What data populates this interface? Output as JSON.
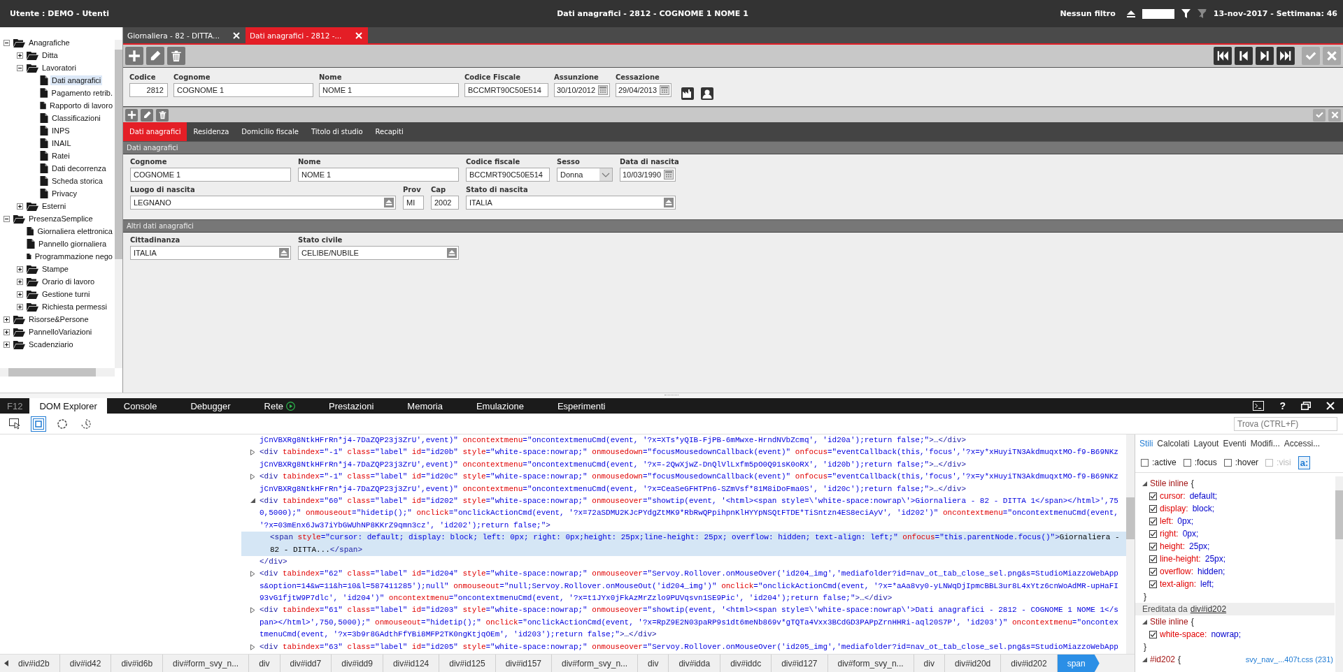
{
  "header": {
    "user": "Utente : DEMO - Utenti",
    "title": "Dati anagrafici - 2812 - COGNOME 1 NOME 1",
    "filter_label": "Nessun filtro",
    "date": "13-nov-2017 - Settimana: 46"
  },
  "tree": [
    {
      "label": "Anagrafiche",
      "kind": "folder",
      "expanded": true,
      "selected": false,
      "children": [
        {
          "label": "Ditta",
          "kind": "folder",
          "expanded": false,
          "selected": false
        },
        {
          "label": "Lavoratori",
          "kind": "folder",
          "expanded": true,
          "selected": false,
          "children": [
            {
              "label": "Dati anagrafici",
              "kind": "document",
              "selected": true
            },
            {
              "label": "Pagamento retrib.",
              "kind": "document",
              "selected": false
            },
            {
              "label": "Rapporto di lavoro",
              "kind": "document",
              "selected": false
            },
            {
              "label": "Classificazioni",
              "kind": "document",
              "selected": false
            },
            {
              "label": "INPS",
              "kind": "document",
              "selected": false
            },
            {
              "label": "INAIL",
              "kind": "document",
              "selected": false
            },
            {
              "label": "Ratei",
              "kind": "document",
              "selected": false
            },
            {
              "label": "Dati decorrenza",
              "kind": "document",
              "selected": false
            },
            {
              "label": "Scheda storica",
              "kind": "document",
              "selected": false
            },
            {
              "label": "Privacy",
              "kind": "document",
              "selected": false
            }
          ]
        },
        {
          "label": "Esterni",
          "kind": "folder",
          "expanded": false,
          "selected": false
        }
      ]
    },
    {
      "label": "PresenzaSemplice",
      "kind": "folder",
      "expanded": true,
      "selected": false,
      "children": [
        {
          "label": "Giornaliera elettronica",
          "kind": "document",
          "selected": false
        },
        {
          "label": "Pannello giornaliera",
          "kind": "document",
          "selected": false
        },
        {
          "label": "Programmazione nego",
          "kind": "document",
          "selected": false
        },
        {
          "label": "Stampe",
          "kind": "folder",
          "expanded": false,
          "selected": false
        },
        {
          "label": "Orario di lavoro",
          "kind": "folder",
          "expanded": false,
          "selected": false
        },
        {
          "label": "Gestione turni",
          "kind": "folder",
          "expanded": false,
          "selected": false
        },
        {
          "label": "Richiesta permessi",
          "kind": "folder",
          "expanded": false,
          "selected": false
        }
      ]
    },
    {
      "label": "Risorse&Persone",
      "kind": "folder",
      "expanded": false,
      "selected": false
    },
    {
      "label": "PannelloVariazioni",
      "kind": "folder",
      "expanded": false,
      "selected": false
    },
    {
      "label": "Scadenziario",
      "kind": "folder",
      "expanded": false,
      "selected": false
    }
  ],
  "doc_tabs": [
    {
      "label": "Giornaliera - 82 - DITTA...",
      "selected": false
    },
    {
      "label": "Dati anagrafici - 2812 -...",
      "selected": true
    }
  ],
  "toolbar": [
    {
      "kind": "add",
      "disabled": false
    },
    {
      "kind": "edit",
      "disabled": false
    },
    {
      "kind": "delete",
      "disabled": false
    },
    {
      "kind": "first",
      "disabled": false
    },
    {
      "kind": "previous",
      "disabled": false
    },
    {
      "kind": "next",
      "disabled": false
    },
    {
      "kind": "last",
      "disabled": false
    },
    {
      "kind": "confirm",
      "disabled": true
    },
    {
      "kind": "cancel",
      "disabled": true
    }
  ],
  "record": [
    {
      "label": "Codice",
      "value": "2812",
      "kind": "number"
    },
    {
      "label": "Cognome",
      "value": "COGNOME 1",
      "kind": "text"
    },
    {
      "label": "Nome",
      "value": "NOME 1",
      "kind": "text"
    },
    {
      "label": "Codice Fiscale",
      "value": "BCCMRT90C50E514",
      "kind": "text"
    },
    {
      "label": "Assunzione",
      "value": "30/10/2012",
      "kind": "date"
    },
    {
      "label": "Cessazione",
      "value": "29/04/2013",
      "kind": "date"
    }
  ],
  "sub_toolbar": [
    {
      "kind": "add",
      "disabled": false
    },
    {
      "kind": "edit",
      "disabled": false
    },
    {
      "kind": "delete",
      "disabled": false
    },
    {
      "kind": "confirm",
      "disabled": true
    },
    {
      "kind": "cancel",
      "disabled": true
    }
  ],
  "sub_tabs": [
    {
      "label": "Dati anagrafici",
      "selected": true
    },
    {
      "label": "Residenza",
      "selected": false
    },
    {
      "label": "Domicilio fiscale",
      "selected": false
    },
    {
      "label": "Titolo di studio",
      "selected": false
    },
    {
      "label": "Recapiti",
      "selected": false
    }
  ],
  "sections": [
    {
      "title": "Dati anagrafici",
      "fields": [
        {
          "label": "Cognome",
          "value": "COGNOME 1",
          "kind": "text"
        },
        {
          "label": "Nome",
          "value": "NOME 1",
          "kind": "text"
        },
        {
          "label": "Codice fiscale",
          "value": "BCCMRT90C50E514",
          "kind": "text"
        },
        {
          "label": "Sesso",
          "value": "Donna",
          "kind": "select"
        },
        {
          "label": "Data di nascita",
          "value": "10/03/1990",
          "kind": "date"
        },
        {
          "label": "Luogo di nascita",
          "value": "LEGNANO",
          "kind": "lookup"
        },
        {
          "label": "Prov",
          "value": "MI",
          "kind": "text"
        },
        {
          "label": "Cap",
          "value": "2002",
          "kind": "text"
        },
        {
          "label": "Stato di nascita",
          "value": "ITALIA",
          "kind": "lookup"
        }
      ]
    },
    {
      "title": "Altri dati anagrafici",
      "fields": [
        {
          "label": "Cittadinanza",
          "value": "ITALIA",
          "kind": "lookup"
        },
        {
          "label": "Stato civile",
          "value": "CELIBE/NUBILE",
          "kind": "lookup"
        }
      ]
    }
  ],
  "devtools": {
    "f12": "F12",
    "tabs": [
      {
        "label": "DOM Explorer",
        "selected": true,
        "kind": "plain"
      },
      {
        "label": "Console",
        "selected": false,
        "kind": "plain"
      },
      {
        "label": "Debugger",
        "selected": false,
        "kind": "plain"
      },
      {
        "label": "Rete",
        "selected": false,
        "kind": "play"
      },
      {
        "label": "Prestazioni",
        "selected": false,
        "kind": "plain"
      },
      {
        "label": "Memoria",
        "selected": false,
        "kind": "plain"
      },
      {
        "label": "Emulazione",
        "selected": false,
        "kind": "plain"
      },
      {
        "label": "Esperimenti",
        "selected": false,
        "kind": "plain"
      }
    ],
    "help": "?",
    "tools": [
      {
        "kind": "select",
        "selected": false
      },
      {
        "kind": "box",
        "selected": true
      },
      {
        "kind": "circle",
        "selected": false
      },
      {
        "kind": "clock",
        "selected": false
      }
    ],
    "find": {
      "placeholder": "Trova (CTRL+F)"
    },
    "dom": [
      {
        "kind": "tail",
        "selected": false,
        "lines": [
          [
            {
              "kind": "val",
              "text": "jCnVBXRg8NtkHFrRn*j4-7DaZQP23j3ZrU',event)\""
            },
            {
              "kind": "attr",
              "text": " oncontextmenu"
            },
            {
              "kind": "val",
              "text": "=\"oncontextmenuCmd(event, '?x=XTs*yQIB-FjPB-6mMwxe-HrndNVbZcmq', 'id20a');return false;\""
            },
            {
              "kind": "tag",
              "text": ">…</div>"
            }
          ]
        ]
      },
      {
        "kind": "collapsed",
        "selected": false,
        "lines": [
          [
            {
              "kind": "tag",
              "text": "<div"
            },
            {
              "kind": "attr",
              "text": " tabindex"
            },
            {
              "kind": "val",
              "text": "=\"-1\""
            },
            {
              "kind": "attr",
              "text": " class"
            },
            {
              "kind": "val",
              "text": "=\"label\""
            },
            {
              "kind": "attr",
              "text": " id"
            },
            {
              "kind": "val",
              "text": "=\"id20b\""
            },
            {
              "kind": "attr",
              "text": " style"
            },
            {
              "kind": "val",
              "text": "=\"white-space:nowrap;\""
            },
            {
              "kind": "attr",
              "text": " onmousedown"
            },
            {
              "kind": "val",
              "text": "=\"focusMousedownCallback(event)\""
            },
            {
              "kind": "attr",
              "text": " onfocus"
            },
            {
              "kind": "val",
              "text": "=\"eventCallback(this,'focus','?x=y*xHuyiTN3AkdmuqxtMO-f9-B69NKz"
            }
          ],
          [
            {
              "kind": "val",
              "text": "jCnVBXRg8NtkHFrRn*j4-7DaZQP23j3ZrU',event)\""
            },
            {
              "kind": "attr",
              "text": " oncontextmenu"
            },
            {
              "kind": "val",
              "text": "=\"oncontextmenuCmd(event, '?x=-2QwXjwZ-DnQlVlLxfm5pO0Q91sK0oRX', 'id20b');return false;\""
            },
            {
              "kind": "tag",
              "text": ">…</div>"
            }
          ]
        ]
      },
      {
        "kind": "collapsed",
        "selected": false,
        "lines": [
          [
            {
              "kind": "tag",
              "text": "<div"
            },
            {
              "kind": "attr",
              "text": " tabindex"
            },
            {
              "kind": "val",
              "text": "=\"-1\""
            },
            {
              "kind": "attr",
              "text": " class"
            },
            {
              "kind": "val",
              "text": "=\"label\""
            },
            {
              "kind": "attr",
              "text": " id"
            },
            {
              "kind": "val",
              "text": "=\"id20c\""
            },
            {
              "kind": "attr",
              "text": " style"
            },
            {
              "kind": "val",
              "text": "=\"white-space:nowrap;\""
            },
            {
              "kind": "attr",
              "text": " onmousedown"
            },
            {
              "kind": "val",
              "text": "=\"focusMousedownCallback(event)\""
            },
            {
              "kind": "attr",
              "text": " onfocus"
            },
            {
              "kind": "val",
              "text": "=\"eventCallback(this,'focus','?x=y*xHuyiTN3AkdmuqxtMO-f9-B69NKz"
            }
          ],
          [
            {
              "kind": "val",
              "text": "jCnVBXRg8NtkHFrRn*j4-7DaZQP23j3ZrU',event)\""
            },
            {
              "kind": "attr",
              "text": " oncontextmenu"
            },
            {
              "kind": "val",
              "text": "=\"oncontextmenuCmd(event, '?x=CeaSeGFHTPn6-SZmVsf*81M8iDoFma0S', 'id20c');return false;\""
            },
            {
              "kind": "tag",
              "text": ">…</div>"
            }
          ]
        ]
      },
      {
        "kind": "expanded",
        "selected": false,
        "lines": [
          [
            {
              "kind": "tag",
              "text": "<div"
            },
            {
              "kind": "attr",
              "text": " tabindex"
            },
            {
              "kind": "val",
              "text": "=\"60\""
            },
            {
              "kind": "attr",
              "text": " class"
            },
            {
              "kind": "val",
              "text": "=\"label\""
            },
            {
              "kind": "attr",
              "text": " id"
            },
            {
              "kind": "val",
              "text": "=\"id202\""
            },
            {
              "kind": "attr",
              "text": " style"
            },
            {
              "kind": "val",
              "text": "=\"white-space:nowrap;\""
            },
            {
              "kind": "attr",
              "text": " onmouseover"
            },
            {
              "kind": "val",
              "text": "=\"showtip(event, '<html><span style=\\'white-space:nowrap\\'>Giornaliera - 82 - DITTA 1</span></html>',75"
            }
          ],
          [
            {
              "kind": "val",
              "text": "0,5000);\""
            },
            {
              "kind": "attr",
              "text": " onmouseout"
            },
            {
              "kind": "val",
              "text": "=\"hidetip();\""
            },
            {
              "kind": "attr",
              "text": " onclick"
            },
            {
              "kind": "val",
              "text": "=\"onclickActionCmd(event, '?x=72aSDMU2KJcPYdgZtMK9*RbRwQPpihpnKlHYYpNSQtFTDE*TiSntzn4ES8eciAyV', 'id202')\""
            },
            {
              "kind": "attr",
              "text": " oncontextmenu"
            },
            {
              "kind": "val",
              "text": "=\"oncontextmenuCmd(event,"
            }
          ],
          [
            {
              "kind": "val",
              "text": "'?x=03mEnx6Jw37iYbGWUhNP8KKrZ9qmn3cz', 'id202');return false;\""
            },
            {
              "kind": "tag",
              "text": ">"
            }
          ]
        ],
        "children": [
          {
            "kind": "leaf",
            "selected": true,
            "lines": [
              [
                {
                  "kind": "tag",
                  "text": "<span"
                },
                {
                  "kind": "attr",
                  "text": " style"
                },
                {
                  "kind": "val",
                  "text": "=\"cursor: default; display: block; left: 0px; right: 0px;height: 25px;line-height: 25px; overflow: hidden; text-align: left;\""
                },
                {
                  "kind": "attr",
                  "text": " onfocus"
                },
                {
                  "kind": "val",
                  "text": "=\"this.parentNode.focus()\""
                },
                {
                  "kind": "tag",
                  "text": ">"
                },
                {
                  "kind": "text",
                  "text": "Giornaliera -"
                }
              ],
              [
                {
                  "kind": "text",
                  "text": "82 - DITTA..."
                },
                {
                  "kind": "tag",
                  "text": "</span>"
                }
              ]
            ]
          }
        ],
        "closing": [
          {
            "kind": "tag",
            "text": "</div>"
          }
        ]
      },
      {
        "kind": "collapsed",
        "selected": false,
        "lines": [
          [
            {
              "kind": "tag",
              "text": "<div"
            },
            {
              "kind": "attr",
              "text": " tabindex"
            },
            {
              "kind": "val",
              "text": "=\"62\""
            },
            {
              "kind": "attr",
              "text": " class"
            },
            {
              "kind": "val",
              "text": "=\"label\""
            },
            {
              "kind": "attr",
              "text": " id"
            },
            {
              "kind": "val",
              "text": "=\"id204\""
            },
            {
              "kind": "attr",
              "text": " style"
            },
            {
              "kind": "val",
              "text": "=\"white-space:nowrap;\""
            },
            {
              "kind": "attr",
              "text": " onmouseover"
            },
            {
              "kind": "val",
              "text": "=\"Servoy.Rollover.onMouseOver('id204_img','mediafolder?id=nav_ot_tab_close_sel.png&s=StudioMiazzoWebApp"
            }
          ],
          [
            {
              "kind": "val",
              "text": "s&option=14&w=11&h=10&l=587411285');null\""
            },
            {
              "kind": "attr",
              "text": " onmouseout"
            },
            {
              "kind": "val",
              "text": "=\"null;Servoy.Rollover.onMouseOut('id204_img')\""
            },
            {
              "kind": "attr",
              "text": " onclick"
            },
            {
              "kind": "val",
              "text": "=\"onclickActionCmd(event, '?x=*aAa8vy0-yLNWqDjIpmcBBL3ur8L4xYtz6cnWoAdMR-upHaFI"
            }
          ],
          [
            {
              "kind": "val",
              "text": "93vG1fjtW9P7dlc', 'id204')\""
            },
            {
              "kind": "attr",
              "text": " oncontextmenu"
            },
            {
              "kind": "val",
              "text": "=\"oncontextmenuCmd(event, '?x=t1JYx0jFkAzMrZzlo9PUVqsvn1SE9Pic', 'id204');return false;\""
            },
            {
              "kind": "tag",
              "text": ">…</div>"
            }
          ]
        ]
      },
      {
        "kind": "collapsed",
        "selected": false,
        "lines": [
          [
            {
              "kind": "tag",
              "text": "<div"
            },
            {
              "kind": "attr",
              "text": " tabindex"
            },
            {
              "kind": "val",
              "text": "=\"61\""
            },
            {
              "kind": "attr",
              "text": " class"
            },
            {
              "kind": "val",
              "text": "=\"label\""
            },
            {
              "kind": "attr",
              "text": " id"
            },
            {
              "kind": "val",
              "text": "=\"id203\""
            },
            {
              "kind": "attr",
              "text": " style"
            },
            {
              "kind": "val",
              "text": "=\"white-space:nowrap;\""
            },
            {
              "kind": "attr",
              "text": " onmouseover"
            },
            {
              "kind": "val",
              "text": "=\"showtip(event, '<html><span style=\\'white-space:nowrap\\'>Dati anagrafici - 2812 - COGNOME 1 NOME 1</s"
            }
          ],
          [
            {
              "kind": "val",
              "text": "pan></html>',750,5000);\""
            },
            {
              "kind": "attr",
              "text": " onmouseout"
            },
            {
              "kind": "val",
              "text": "=\"hidetip();\""
            },
            {
              "kind": "attr",
              "text": " onclick"
            },
            {
              "kind": "val",
              "text": "=\"onclickActionCmd(event, '?x=RpZ9E2N03paRP9s1dt6meNb869v*gTQTa4Vxx3BCdGD3PAPpZrnHHRi-aql20S7P', 'id203')\""
            },
            {
              "kind": "attr",
              "text": " oncontextmenu"
            },
            {
              "kind": "val",
              "text": "=\"oncontex"
            }
          ],
          [
            {
              "kind": "val",
              "text": "tmenuCmd(event, '?x=3b9r8GAdthFfYBi8MFP2TK0ngKtjqOEm', 'id203');return false;\""
            },
            {
              "kind": "tag",
              "text": ">…</div>"
            }
          ]
        ]
      },
      {
        "kind": "collapsed",
        "selected": false,
        "lines": [
          [
            {
              "kind": "tag",
              "text": "<div"
            },
            {
              "kind": "attr",
              "text": " tabindex"
            },
            {
              "kind": "val",
              "text": "=\"63\""
            },
            {
              "kind": "attr",
              "text": " class"
            },
            {
              "kind": "val",
              "text": "=\"label\""
            },
            {
              "kind": "attr",
              "text": " id"
            },
            {
              "kind": "val",
              "text": "=\"id205\""
            },
            {
              "kind": "attr",
              "text": " style"
            },
            {
              "kind": "val",
              "text": "=\"white-space:nowrap;\""
            },
            {
              "kind": "attr",
              "text": " onmouseover"
            },
            {
              "kind": "val",
              "text": "=\"Servoy.Rollover.onMouseOver('id205_img','mediafolder?id=nav_ot_tab_close_sel.png&s=StudioMiazzoWebApp"
            }
          ]
        ]
      }
    ],
    "breadcrumbs": [
      {
        "label": "div#id2b",
        "selected": false
      },
      {
        "label": "div#id42",
        "selected": false
      },
      {
        "label": "div#id6b",
        "selected": false
      },
      {
        "label": "div#form_svy_n...",
        "selected": false
      },
      {
        "label": "div",
        "selected": false
      },
      {
        "label": "div#idd7",
        "selected": false
      },
      {
        "label": "div#idd9",
        "selected": false
      },
      {
        "label": "div#id124",
        "selected": false
      },
      {
        "label": "div#id125",
        "selected": false
      },
      {
        "label": "div#id157",
        "selected": false
      },
      {
        "label": "div#form_svy_n...",
        "selected": false
      },
      {
        "label": "div",
        "selected": false
      },
      {
        "label": "div#idda",
        "selected": false
      },
      {
        "label": "div#iddc",
        "selected": false
      },
      {
        "label": "div#id127",
        "selected": false
      },
      {
        "label": "div#form_svy_n...",
        "selected": false
      },
      {
        "label": "div",
        "selected": false
      },
      {
        "label": "div#id20d",
        "selected": false
      },
      {
        "label": "div#id202",
        "selected": false
      },
      {
        "label": "span",
        "selected": true
      }
    ],
    "style_tabs": [
      {
        "label": "Stili",
        "selected": true
      },
      {
        "label": "Calcolati",
        "selected": false
      },
      {
        "label": "Layout",
        "selected": false
      },
      {
        "label": "Eventi",
        "selected": false
      },
      {
        "label": "Modifi...",
        "selected": false
      },
      {
        "label": "Accessi...",
        "selected": false
      }
    ],
    "states": [
      {
        "label": ":active",
        "checked": false,
        "disabled": false
      },
      {
        "label": ":focus",
        "checked": false,
        "disabled": false
      },
      {
        "label": ":hover",
        "checked": false,
        "disabled": false
      },
      {
        "label": ":visi",
        "checked": false,
        "disabled": true
      }
    ],
    "text_toggle": {
      "label": "a:",
      "selected": true
    },
    "rules": [
      {
        "kind": "rule",
        "selector": "Stile inline",
        "open": "{",
        "props": [
          {
            "name": "cursor:",
            "value": "default;",
            "checked": true
          },
          {
            "name": "display:",
            "value": "block;",
            "checked": true
          },
          {
            "name": "left:",
            "value": "0px;",
            "checked": true
          },
          {
            "name": "right:",
            "value": "0px;",
            "checked": true
          },
          {
            "name": "height:",
            "value": "25px;",
            "checked": true
          },
          {
            "name": "line-height:",
            "value": "25px;",
            "checked": true
          },
          {
            "name": "overflow:",
            "value": "hidden;",
            "checked": true
          },
          {
            "name": "text-align:",
            "value": "left;",
            "checked": true
          }
        ],
        "close": "}"
      },
      {
        "kind": "inherited",
        "label": "Ereditata da",
        "link": "div#id202"
      },
      {
        "kind": "rule",
        "selector": "Stile inline",
        "open": "{",
        "props": [
          {
            "name": "white-space:",
            "value": "nowrap;",
            "checked": true
          }
        ],
        "close": "}"
      },
      {
        "kind": "rule",
        "selector": "#id202",
        "open": "{",
        "source": "svy_nav_...407t.css (231)"
      }
    ]
  }
}
